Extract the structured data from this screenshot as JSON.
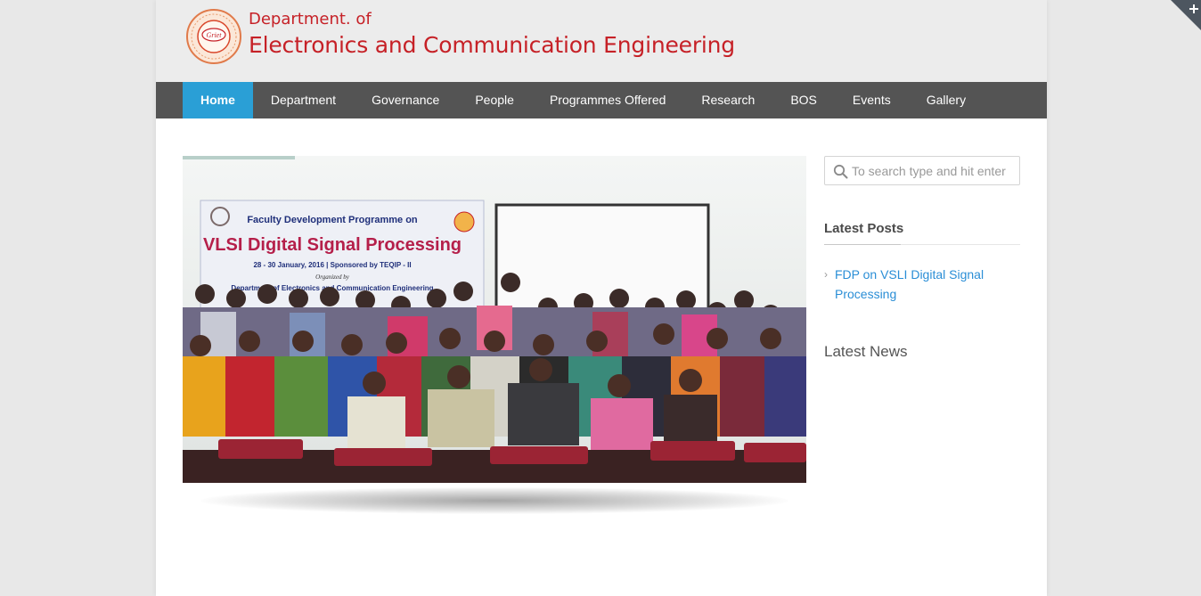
{
  "header": {
    "dept_small": "Department. of",
    "dept_big": "Electronics and Communication Engineering",
    "logo_text": "Griet"
  },
  "nav": {
    "items": [
      "Home",
      "Department",
      "Governance",
      "People",
      "Programmes Offered",
      "Research",
      "BOS",
      "Events",
      "Gallery"
    ],
    "active": "Home"
  },
  "slider": {
    "progress": 0.18,
    "banner_line1": "Faculty Development Programme on",
    "banner_title": "VLSI Digital Signal Processing",
    "banner_line3": "28 - 30 January, 2016  |  Sponsored by TEQIP - II",
    "banner_line4": "Organized by",
    "banner_line5": "Department of Electronics and Communication Engineering"
  },
  "sidebar": {
    "search_placeholder": "To search type and hit enter",
    "latest_posts_title": "Latest Posts",
    "posts": [
      "FDP on VSLI Digital Signal Processing"
    ],
    "latest_news_title": "Latest News"
  },
  "colors": {
    "brand_red": "#c62127",
    "nav_bg": "#545454",
    "nav_active": "#2a9fd6",
    "link": "#2a8ed6"
  },
  "icons": {
    "search": "search-icon",
    "corner": "plus-icon",
    "post_bullet": "chevron-right-icon"
  }
}
